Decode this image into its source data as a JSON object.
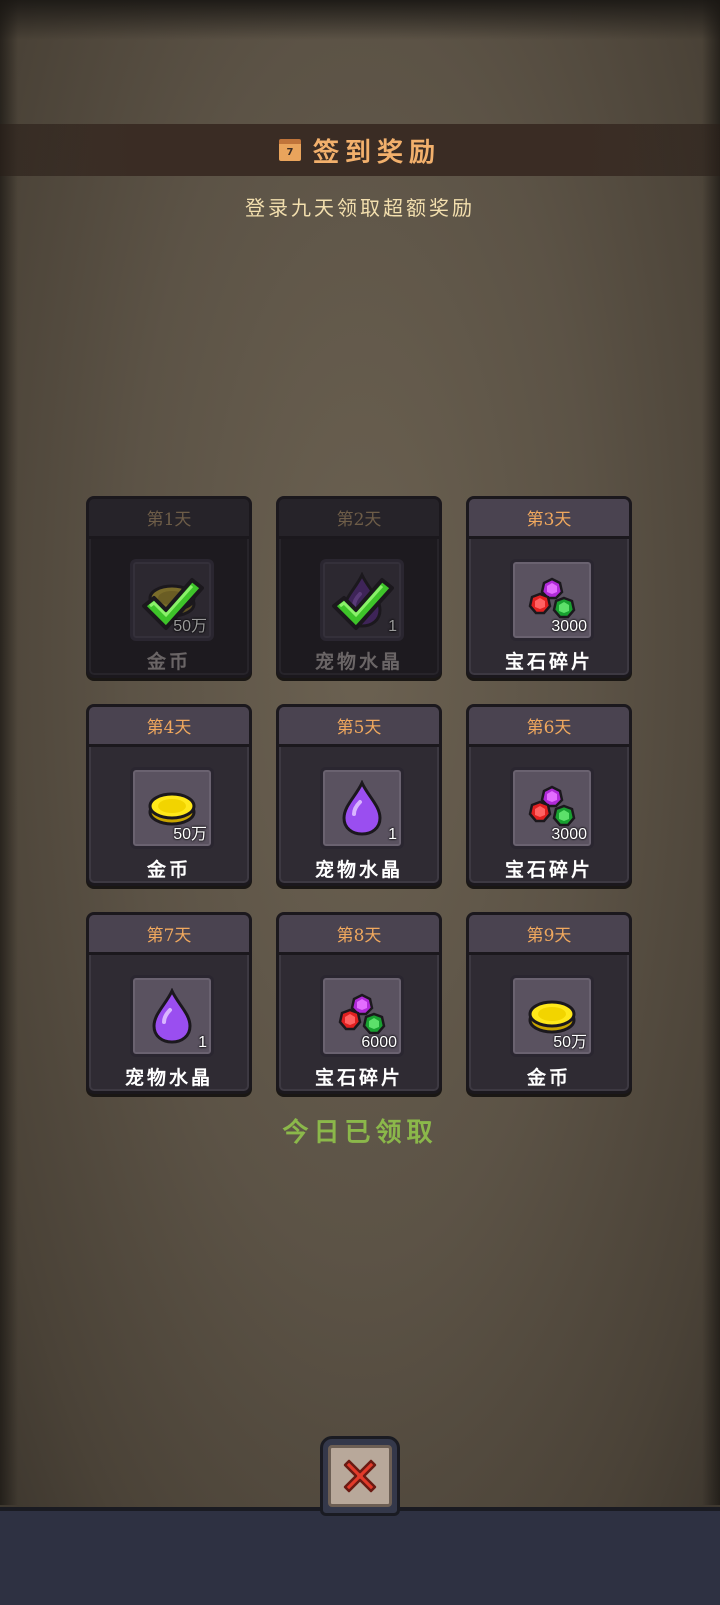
{
  "header": {
    "calendar_day": "7",
    "title": "签到奖励",
    "subtitle": "登录九天领取超额奖励"
  },
  "rewards": [
    {
      "day": "第1天",
      "name": "金币",
      "qty": "50万",
      "icon": "gold-coin-icon",
      "claimed": true
    },
    {
      "day": "第2天",
      "name": "宠物水晶",
      "qty": "1",
      "icon": "pet-crystal-icon",
      "claimed": true
    },
    {
      "day": "第3天",
      "name": "宝石碎片",
      "qty": "3000",
      "icon": "gem-shards-icon",
      "claimed": false
    },
    {
      "day": "第4天",
      "name": "金币",
      "qty": "50万",
      "icon": "gold-coin-icon",
      "claimed": false
    },
    {
      "day": "第5天",
      "name": "宠物水晶",
      "qty": "1",
      "icon": "pet-crystal-icon",
      "claimed": false
    },
    {
      "day": "第6天",
      "name": "宝石碎片",
      "qty": "3000",
      "icon": "gem-shards-icon",
      "claimed": false
    },
    {
      "day": "第7天",
      "name": "宠物水晶",
      "qty": "1",
      "icon": "pet-crystal-icon",
      "claimed": false
    },
    {
      "day": "第8天",
      "name": "宝石碎片",
      "qty": "6000",
      "icon": "gem-shards-icon",
      "claimed": false
    },
    {
      "day": "第9天",
      "name": "金币",
      "qty": "50万",
      "icon": "gold-coin-icon",
      "claimed": false
    }
  ],
  "status_text": "今日已领取",
  "colors": {
    "title": "#f2b06c",
    "subtitle": "#f3dfae",
    "day_label": "#f0a85e",
    "status": "#8bb84a",
    "close_x": "#e23a2a"
  }
}
